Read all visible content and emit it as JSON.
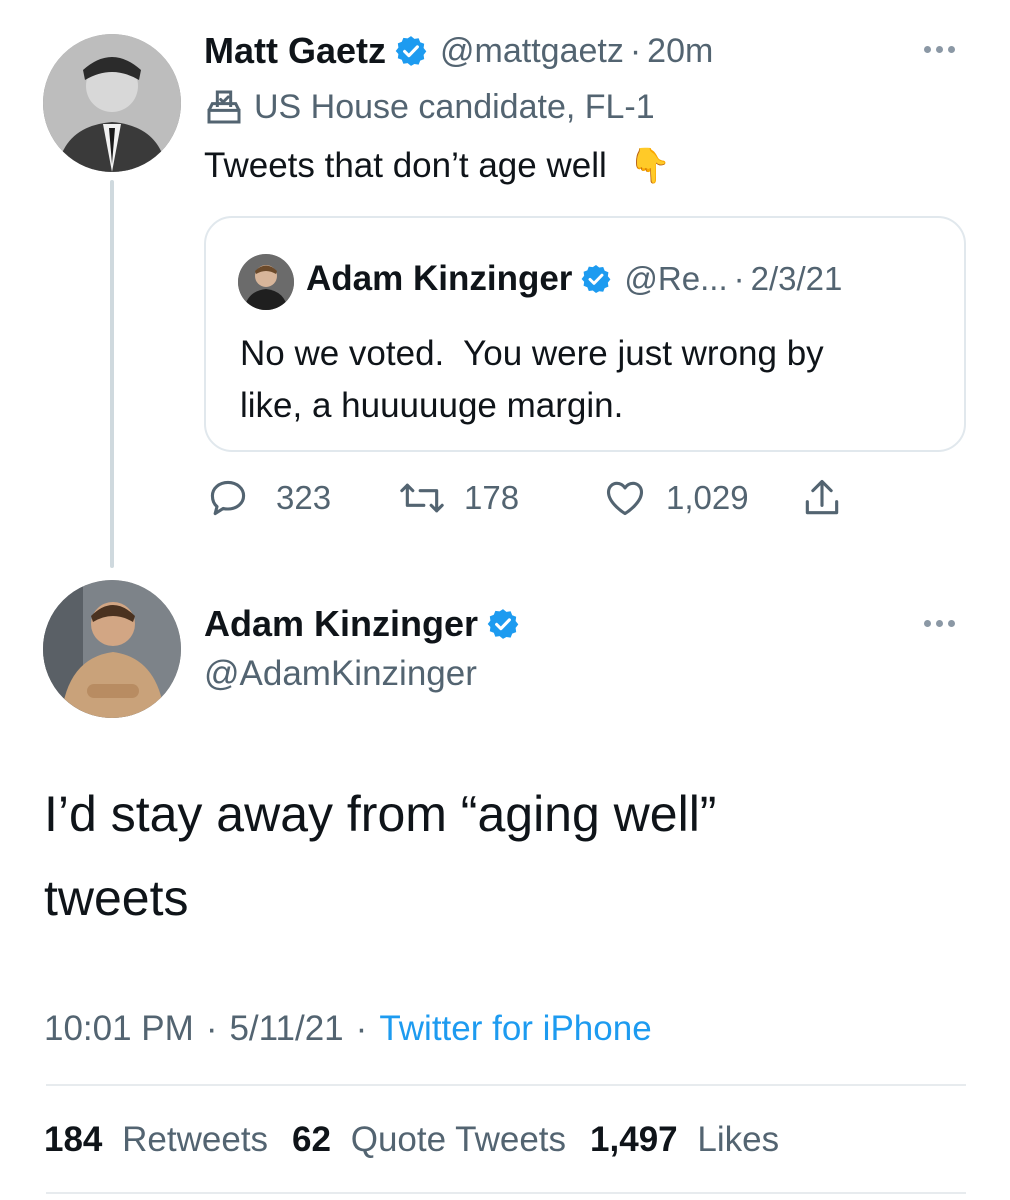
{
  "tweet1": {
    "name": "Matt Gaetz",
    "handle": "@mattgaetz",
    "sep": "·",
    "time": "20m",
    "label": "US House candidate, FL-1",
    "text": "Tweets that don’t age well",
    "emoji": "👇",
    "quoted": {
      "name": "Adam Kinzinger",
      "handle": "@Re...",
      "sep": "·",
      "date": "2/3/21",
      "text_line1": "No we voted.  You were just wrong by",
      "text_line2": "like, a huuuuuge margin."
    },
    "actions": {
      "replies": "323",
      "retweets": "178",
      "likes": "1,029"
    }
  },
  "tweet2": {
    "name": "Adam Kinzinger",
    "handle": "@AdamKinzinger",
    "text_line1": "I’d stay away from “aging well”",
    "text_line2": "tweets",
    "time": "10:01 PM",
    "sep1": "·",
    "date": "5/11/21",
    "sep2": "·",
    "source": "Twitter for iPhone",
    "stats": {
      "retweets_count": "184",
      "retweets_label": "Retweets",
      "quotes_count": "62",
      "quotes_label": "Quote Tweets",
      "likes_count": "1,497",
      "likes_label": "Likes"
    }
  },
  "colors": {
    "verified": "#1d9bf0",
    "link": "#1d9bf0",
    "secondary_text": "#536471",
    "primary_text": "#0f1419"
  }
}
